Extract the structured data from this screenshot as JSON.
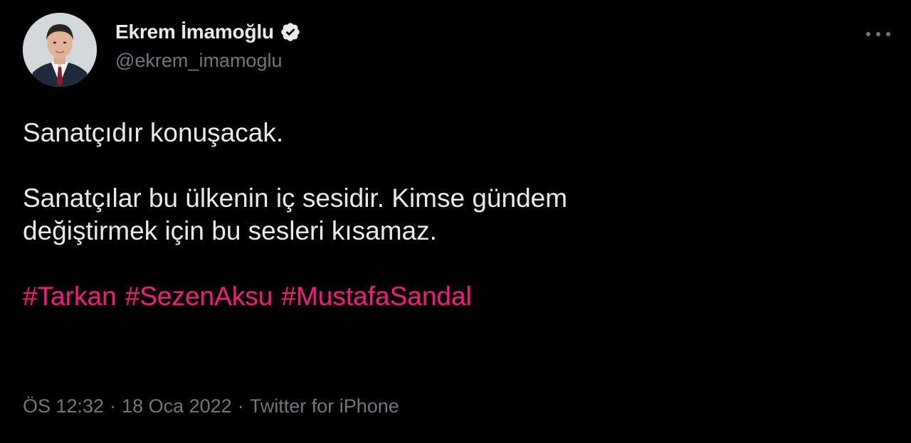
{
  "author": {
    "display_name": "Ekrem İmamoğlu",
    "handle": "@ekrem_imamoglu",
    "verified_icon": "verified-badge-icon",
    "avatar_icon": "profile-photo"
  },
  "more_icon": "more-horizontal-icon",
  "tweet": {
    "line1": "Sanatçıdır konuşacak.",
    "line2": "Sanatçılar bu ülkenin iç sesidir. Kimse gündem",
    "line3": "değiştirmek için bu sesleri kısamaz.",
    "hashtags": [
      "#Tarkan",
      "#SezenAksu",
      "#MustafaSandal"
    ]
  },
  "meta": {
    "time": "ÖS 12:32",
    "separator": "·",
    "date": "18 Oca 2022",
    "source": "Twitter for iPhone"
  },
  "colors": {
    "background": "#000000",
    "text": "#e7e9ea",
    "secondary": "#71767b",
    "hashtag": "#f91880"
  }
}
